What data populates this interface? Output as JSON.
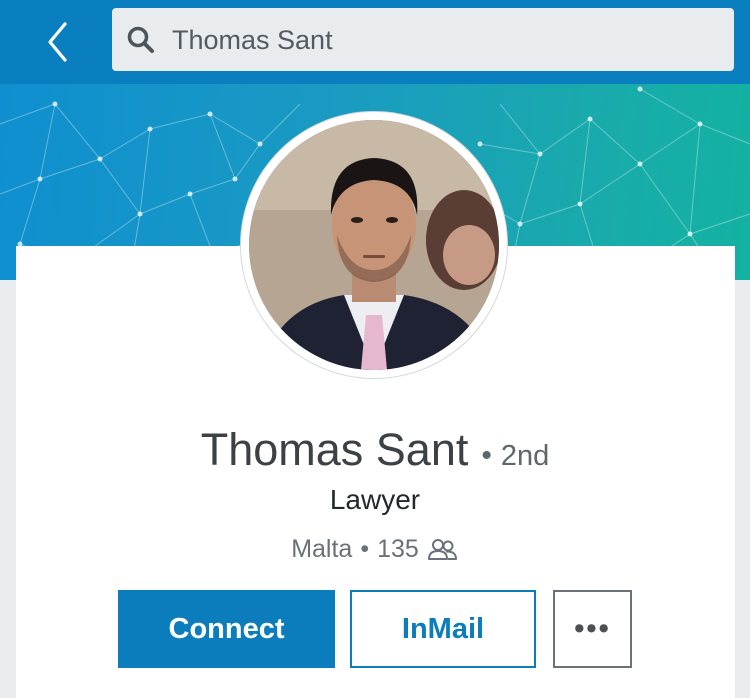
{
  "topbar": {
    "back_icon": "chevron-left-icon",
    "search": {
      "icon": "search-icon",
      "value": "Thomas Sant"
    },
    "color": "#0a7fc0"
  },
  "profile": {
    "name": "Thomas Sant",
    "separator": "•",
    "degree": "2nd",
    "headline": "Lawyer",
    "location": "Malta",
    "meta_separator": "•",
    "connections": "135",
    "connections_icon": "people-icon"
  },
  "actions": {
    "connect_label": "Connect",
    "inmail_label": "InMail",
    "more_label": "•••",
    "accent": "#0b7dbd"
  }
}
